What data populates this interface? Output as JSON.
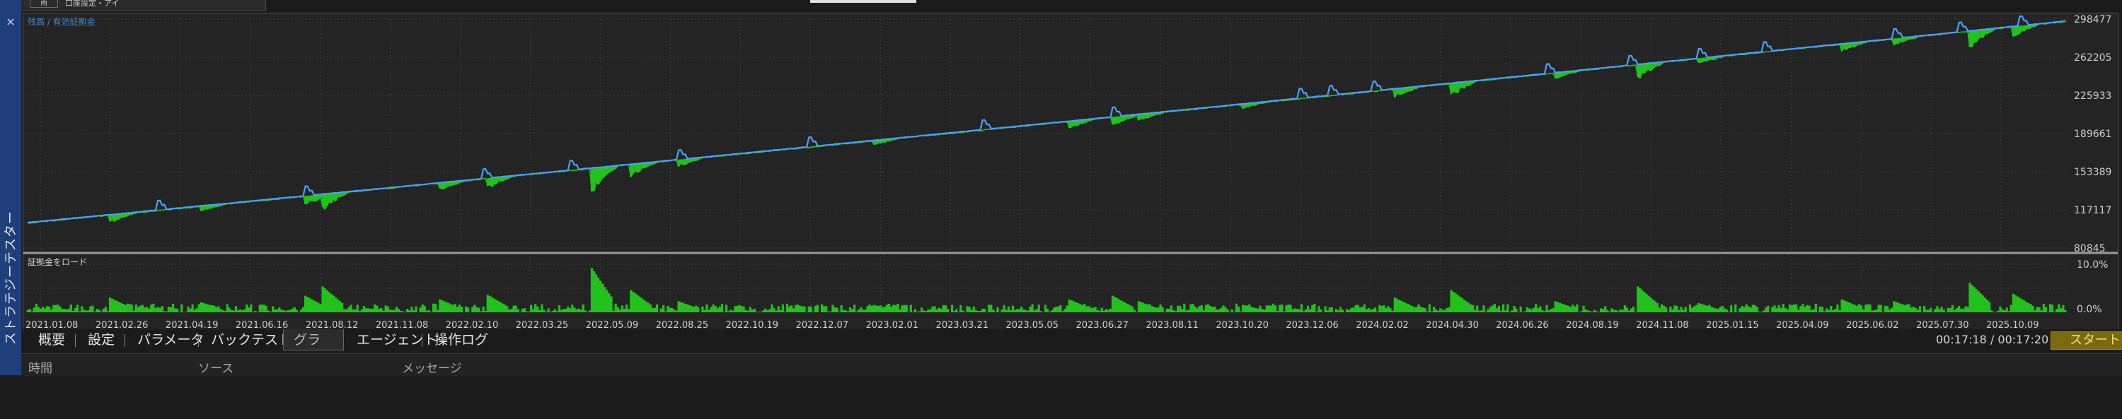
{
  "sidebar": {
    "close_glyph": "×",
    "title": "ストラテジーテスター"
  },
  "top": {
    "checkbox_label": "雨",
    "popup_text": "口座設定・アイ"
  },
  "chart_data": {
    "type": "line",
    "legend": "残高 / 有効証拠金",
    "subpanel_label": "証拠金をロード",
    "y_ticks": [
      "298477",
      "262205",
      "225933",
      "189661",
      "153389",
      "117117",
      "80845"
    ],
    "y_range": [
      80845,
      298477
    ],
    "load_ticks": [
      "10.0%",
      "0.0%"
    ],
    "x_labels": [
      "2021.01.08",
      "2021.02.26",
      "2021.04.19",
      "2021.06.16",
      "2021.08.12",
      "2021.11.08",
      "2022.02.10",
      "2022.03.25",
      "2022.05.09",
      "2022.08.25",
      "2022.10.19",
      "2022.12.07",
      "2023.02.01",
      "2023.03.21",
      "2023.05.05",
      "2023.06.27",
      "2023.08.11",
      "2023.10.20",
      "2023.12.06",
      "2024.02.02",
      "2024.04.30",
      "2024.06.26",
      "2024.08.19",
      "2024.11.08",
      "2025.01.15",
      "2025.04.09",
      "2025.06.02",
      "2025.07.30",
      "2025.10.09"
    ],
    "series": [
      {
        "name": "残高",
        "color": "#4aa0ff"
      },
      {
        "name": "有効証拠金",
        "color": "#22c11b"
      }
    ],
    "balance_start": 105000,
    "balance_end": 296500,
    "colors": {
      "grid": "#3c3c3c",
      "axis_text": "#cfcfcf",
      "legend_text": "#3a8ad8",
      "load_fill": "#22c11b"
    }
  },
  "tabs": [
    {
      "id": "summary",
      "label": "概要"
    },
    {
      "id": "settings",
      "label": "設定"
    },
    {
      "id": "params",
      "label": "パラメータ"
    },
    {
      "id": "backtest",
      "label": "バックテスト"
    },
    {
      "id": "graph",
      "label": "グラフ"
    },
    {
      "id": "agents",
      "label": "エージェント"
    },
    {
      "id": "log",
      "label": "操作ログ"
    }
  ],
  "status": {
    "timer": "00:17:18 / 00:17:20",
    "start_label": "スタート"
  },
  "log": {
    "col_time": "時間",
    "col_source": "ソース",
    "col_message": "メッセージ"
  }
}
